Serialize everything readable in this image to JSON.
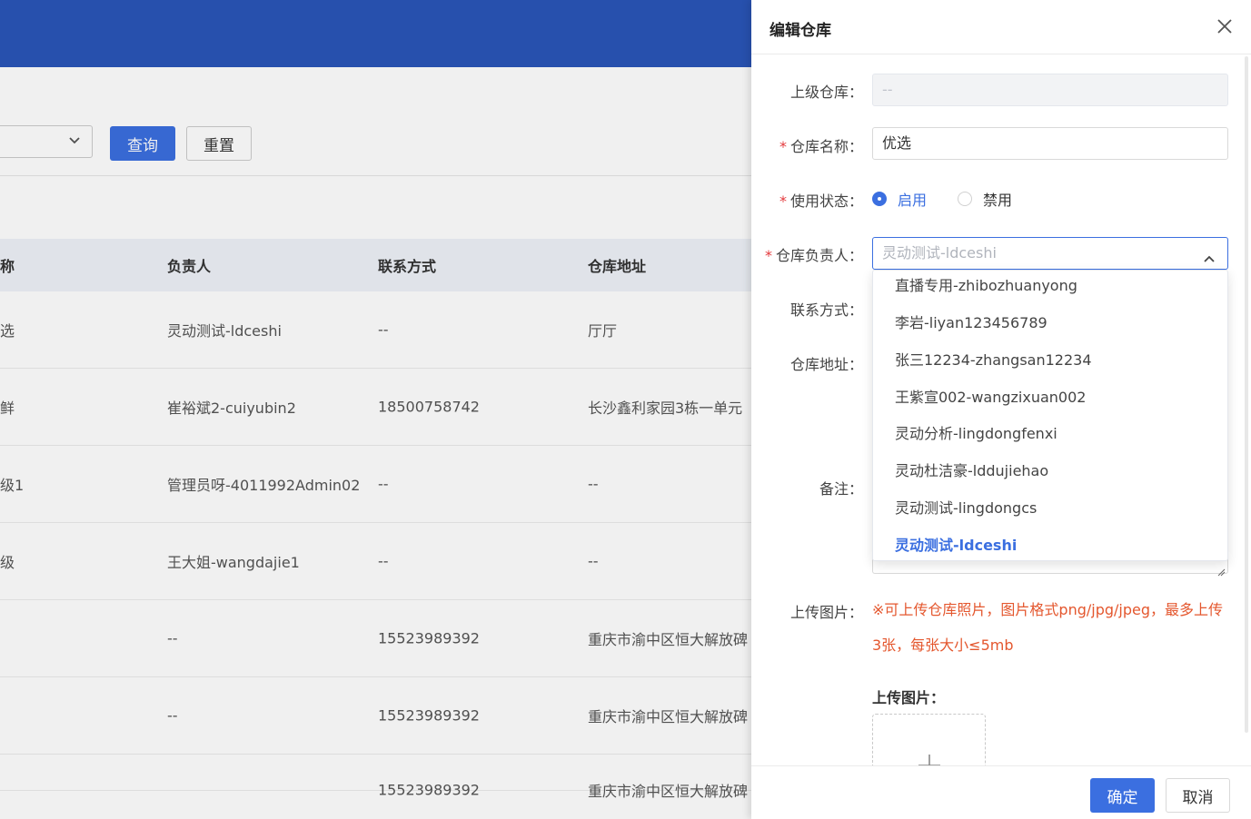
{
  "background": {
    "search": {
      "query_label": "查询",
      "reset_label": "重置"
    },
    "table": {
      "headers": [
        "称",
        "负责人",
        "联系方式",
        "仓库地址"
      ],
      "rows": [
        [
          "选",
          "灵动测试-ldceshi",
          "--",
          "厅厅"
        ],
        [
          "鲜",
          "崔裕斌2-cuiyubin2",
          "18500758742",
          "长沙鑫利家园3栋一单元"
        ],
        [
          "级1",
          "管理员呀-4011992Admin02",
          "--",
          "--"
        ],
        [
          "级",
          "王大姐-wangdajie1",
          "--",
          "--"
        ],
        [
          "",
          "--",
          "15523989392",
          "重庆市渝中区恒大解放碑"
        ],
        [
          "",
          "--",
          "15523989392",
          "重庆市渝中区恒大解放碑"
        ],
        [
          "",
          "",
          "15523989392",
          "重庆市渝中区恒大解放碑"
        ]
      ]
    }
  },
  "drawer": {
    "title": "编辑仓库",
    "fields": {
      "parent": {
        "label": "上级仓库：",
        "value": "--"
      },
      "name": {
        "label": "仓库名称：",
        "value": "优选"
      },
      "status": {
        "label": "使用状态：",
        "options": [
          "启用",
          "禁用"
        ],
        "selected": "启用"
      },
      "manager": {
        "label": "仓库负责人：",
        "value": "灵动测试-ldceshi"
      },
      "contact": {
        "label": "联系方式："
      },
      "address": {
        "label": "仓库地址："
      },
      "remark": {
        "label": "备注："
      },
      "upload": {
        "label": "上传图片：",
        "hint": "※可上传仓库照片，图片格式png/jpg/jpeg，最多上传3张，每张大小≤5mb",
        "title": "上传图片："
      }
    },
    "dropdown_options": [
      "直播专用-zhibozhuanyong",
      "李岩-liyan123456789",
      "张三12234-zhangsan12234",
      "王紫宣002-wangzixuan002",
      "灵动分析-lingdongfenxi",
      "灵动杜洁豪-lddujiehao",
      "灵动测试-lingdongcs",
      "灵动测试-ldceshi"
    ],
    "dropdown_selected": "灵动测试-ldceshi",
    "footer": {
      "ok_label": "确定",
      "cancel_label": "取消"
    }
  }
}
